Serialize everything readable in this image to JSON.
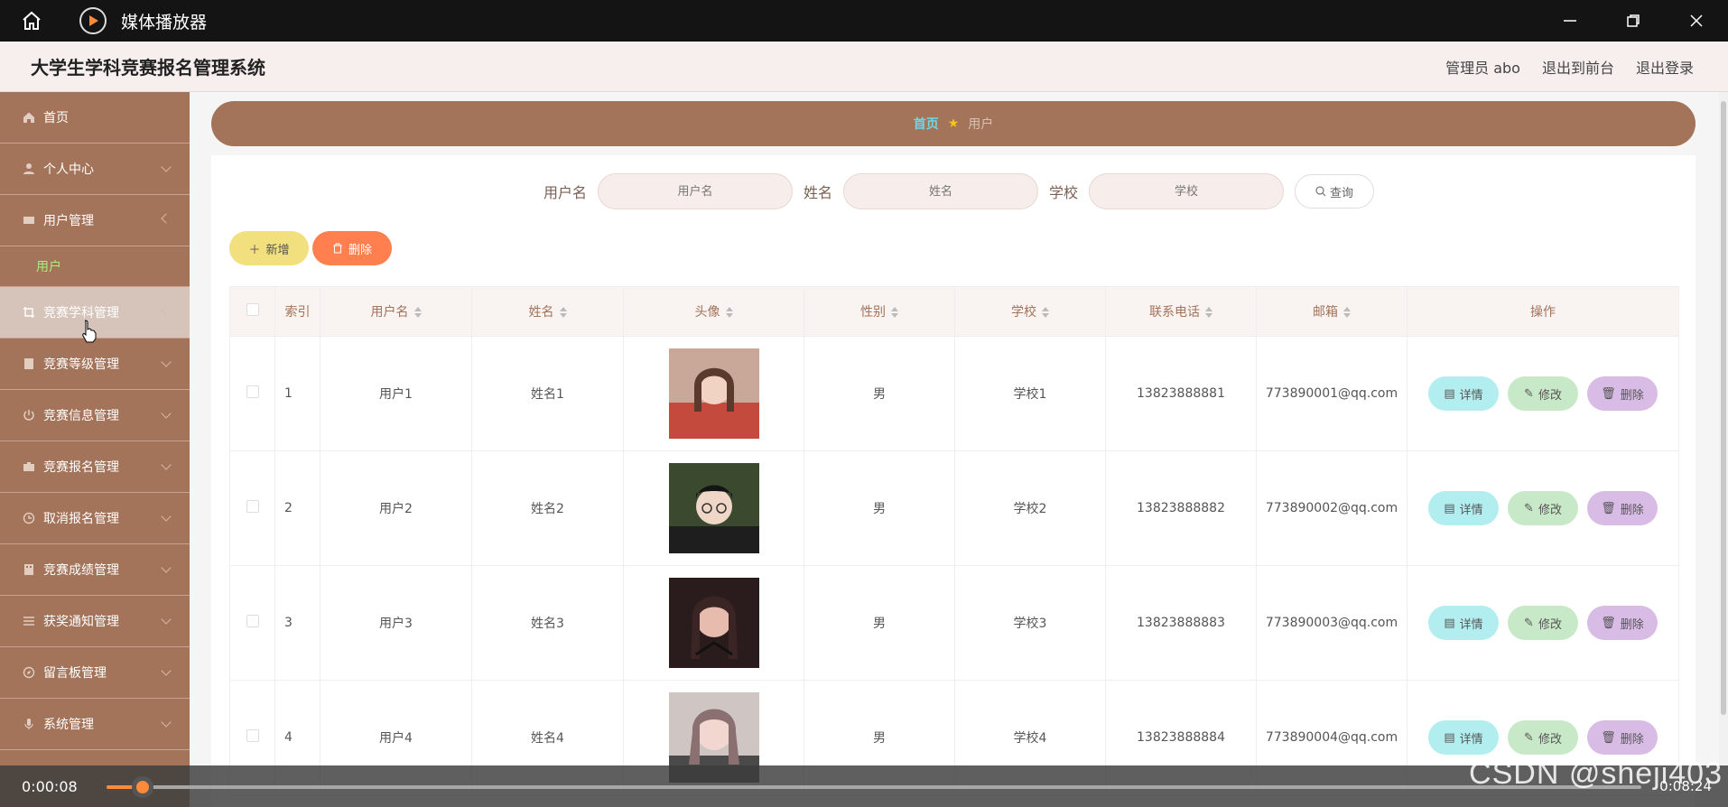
{
  "window": {
    "title": "媒体播放器"
  },
  "header": {
    "app_title": "大学生学科竞赛报名管理系统",
    "admin_label": "管理员 abo",
    "to_front_label": "退出到前台",
    "logout_label": "退出登录"
  },
  "sidebar": {
    "items": [
      {
        "label": "首页",
        "icon": "home-icon"
      },
      {
        "label": "个人中心",
        "icon": "user-icon"
      },
      {
        "label": "用户管理",
        "icon": "users-icon"
      },
      {
        "label": "竞赛学科管理",
        "icon": "crop-icon"
      },
      {
        "label": "竞赛等级管理",
        "icon": "book-icon"
      },
      {
        "label": "竞赛信息管理",
        "icon": "power-icon"
      },
      {
        "label": "竞赛报名管理",
        "icon": "briefcase-icon"
      },
      {
        "label": "取消报名管理",
        "icon": "clock-icon"
      },
      {
        "label": "竞赛成绩管理",
        "icon": "building-icon"
      },
      {
        "label": "获奖通知管理",
        "icon": "list-icon"
      },
      {
        "label": "留言板管理",
        "icon": "compass-icon"
      },
      {
        "label": "系统管理",
        "icon": "mic-icon"
      }
    ],
    "sub_item": "用户"
  },
  "breadcrumb": {
    "home": "首页",
    "current": "用户"
  },
  "search": {
    "username_label": "用户名",
    "username_placeholder": "用户名",
    "name_label": "姓名",
    "name_placeholder": "姓名",
    "school_label": "学校",
    "school_placeholder": "学校",
    "query_label": "查询"
  },
  "actions": {
    "add_label": "新增",
    "delete_label": "删除"
  },
  "table": {
    "headers": [
      "索引",
      "用户名",
      "姓名",
      "头像",
      "性别",
      "学校",
      "联系电话",
      "邮箱",
      "操作"
    ],
    "rows": [
      {
        "index": "1",
        "username": "用户1",
        "name": "姓名1",
        "gender": "男",
        "school": "学校1",
        "phone": "13823888881",
        "email": "773890001@qq.com"
      },
      {
        "index": "2",
        "username": "用户2",
        "name": "姓名2",
        "gender": "男",
        "school": "学校2",
        "phone": "13823888882",
        "email": "773890002@qq.com"
      },
      {
        "index": "3",
        "username": "用户3",
        "name": "姓名3",
        "gender": "男",
        "school": "学校3",
        "phone": "13823888883",
        "email": "773890003@qq.com"
      },
      {
        "index": "4",
        "username": "用户4",
        "name": "姓名4",
        "gender": "男",
        "school": "学校4",
        "phone": "13823888884",
        "email": "773890004@qq.com"
      }
    ],
    "op_detail": "详情",
    "op_edit": "修改",
    "op_delete": "删除"
  },
  "player": {
    "current_time": "0:00:08",
    "total_time": "0:08:24"
  },
  "watermark": "CSDN @sheji403",
  "colors": {
    "sidebar": "#a3735a",
    "add": "#f2df7e",
    "delete": "#ff7f4e",
    "detail": "#b2eef0",
    "edit": "#c8e9c7",
    "row_delete": "#d9bce6"
  }
}
